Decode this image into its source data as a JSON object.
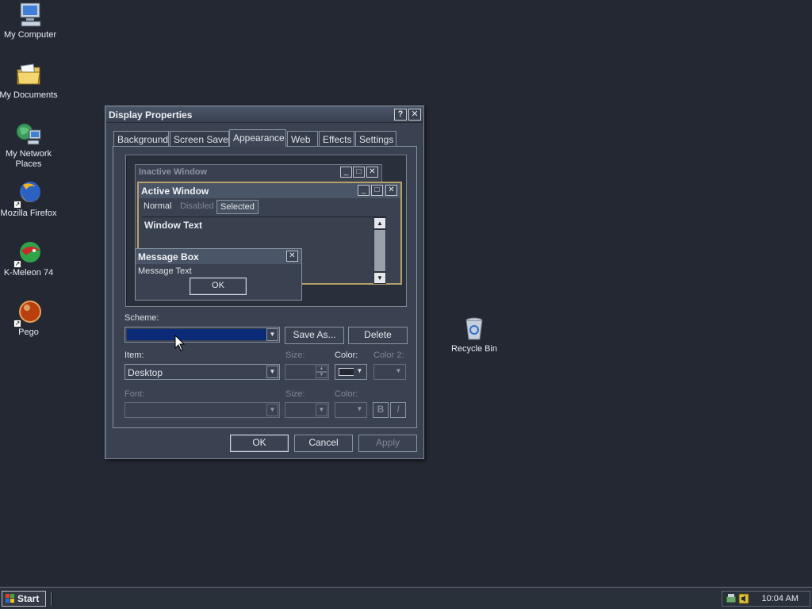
{
  "desktop": {
    "icons": [
      {
        "label": "My Computer"
      },
      {
        "label": "My Documents"
      },
      {
        "label": "My Network Places"
      },
      {
        "label": "Mozilla Firefox"
      },
      {
        "label": "K-Meleon 74"
      },
      {
        "label": "Pego"
      },
      {
        "label": "Recycle Bin"
      }
    ]
  },
  "dialog": {
    "title": "Display Properties",
    "help_btn": "?",
    "close_btn": "✕",
    "tabs": [
      "Background",
      "Screen Saver",
      "Appearance",
      "Web",
      "Effects",
      "Settings"
    ],
    "active_tab": "Appearance",
    "preview": {
      "inactive_title": "Inactive Window",
      "active_title": "Active Window",
      "menu_normal": "Normal",
      "menu_disabled": "Disabled",
      "menu_selected": "Selected",
      "window_text": "Window Text",
      "msgbox_title": "Message Box",
      "msgbox_text": "Message Text",
      "msgbox_ok": "OK"
    },
    "scheme": {
      "label": "Scheme:",
      "value": "",
      "save_as": "Save As...",
      "delete": "Delete"
    },
    "item": {
      "label": "Item:",
      "value": "Desktop",
      "size_label": "Size:",
      "color_label": "Color:",
      "color2_label": "Color 2:"
    },
    "font": {
      "label": "Font:",
      "size_label": "Size:",
      "color_label": "Color:",
      "bold": "B",
      "italic": "I"
    },
    "buttons": {
      "ok": "OK",
      "cancel": "Cancel",
      "apply": "Apply"
    }
  },
  "taskbar": {
    "start": "Start",
    "clock": "10:04 AM"
  },
  "colors": {
    "desktop_bg": "#232832",
    "scheme_selected": "#0b2a78"
  }
}
